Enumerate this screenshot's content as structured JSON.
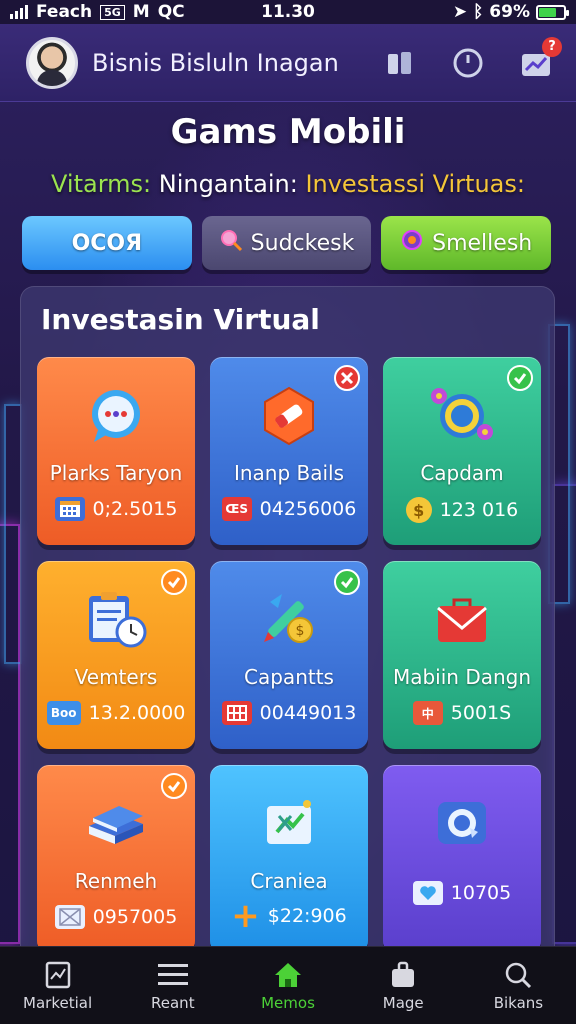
{
  "status": {
    "carrier": "Feach",
    "sim": "5G",
    "app_letter": "M",
    "extra": "QC",
    "time": "11.30",
    "battery_percent": "69%",
    "battery_level": 0.69,
    "battery_color": "#3fd34a"
  },
  "header": {
    "title": "Bisnis Bisluln Inagan",
    "notification_count": "?"
  },
  "page": {
    "title": "Gams Mobili",
    "subtitle_part1": "Vitarms:",
    "subtitle_part2": " Ningantain:",
    "subtitle_part3": " Investassi Virtuas:"
  },
  "buttons": {
    "first": "OCOЯ",
    "second": "Sudckesk",
    "third": "Smellesh"
  },
  "panel": {
    "title": "Investasin Virtual"
  },
  "cards": [
    {
      "name": "Plarks Taryon",
      "value": "0;2.5015",
      "value_icon": "",
      "icon": "chat-bubble-icon",
      "corner": ""
    },
    {
      "name": "Inanp Bails",
      "value": "04256006",
      "value_icon": "ŒS",
      "icon": "eraser-hexagon-icon",
      "corner": "x"
    },
    {
      "name": "Capdam",
      "value": "123 016",
      "value_icon": "$",
      "icon": "gears-icon",
      "corner": "check"
    },
    {
      "name": "Vemters",
      "value": "13.2.0000",
      "value_icon": "Boo",
      "icon": "clipboard-clock-icon",
      "corner": "check-orange"
    },
    {
      "name": "Capantts",
      "value": "00449013",
      "value_icon": "",
      "icon": "pencil-coin-icon",
      "corner": "check"
    },
    {
      "name": "Mabiin Dangn",
      "value": "5001S",
      "value_icon": "中",
      "icon": "mail-bag-icon",
      "corner": ""
    },
    {
      "name": "Renmeh",
      "value": "0957005",
      "value_icon": "",
      "icon": "books-icon",
      "corner": "check-orange"
    },
    {
      "name": "Craniea",
      "value": "$22:906",
      "value_icon": "+",
      "icon": "spreadsheet-icon",
      "corner": ""
    },
    {
      "name": "",
      "value": "10705",
      "value_icon": "",
      "icon": "camera-lens-icon",
      "corner": ""
    }
  ],
  "nav": [
    {
      "label": "Marketial",
      "icon": "chart-doc-icon",
      "active": false
    },
    {
      "label": "Reant",
      "icon": "menu-icon",
      "active": false
    },
    {
      "label": "Memos",
      "icon": "home-icon",
      "active": true
    },
    {
      "label": "Mage",
      "icon": "bag-icon",
      "active": false
    },
    {
      "label": "Bikans",
      "icon": "search-icon",
      "active": false
    }
  ],
  "colors": {
    "accent_green": "#4cd137",
    "subtitle_green": "#9be34f",
    "subtitle_yellow": "#f4c638",
    "button_blue": "#2b8ef0",
    "button_green": "#5fb82a"
  }
}
